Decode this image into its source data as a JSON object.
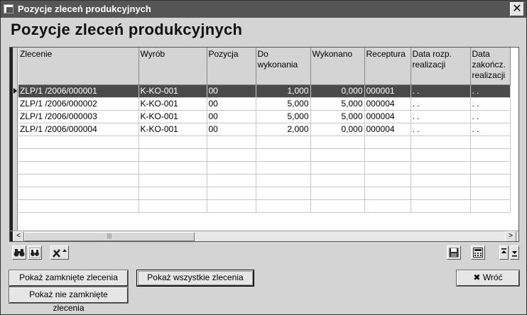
{
  "window": {
    "title": "Pozycje zleceń produkcyjnych",
    "close_glyph": "✕"
  },
  "heading": "Pozycje zleceń produkcyjnych",
  "grid": {
    "columns": [
      {
        "key": "zlecenie",
        "label": "Zlecenie"
      },
      {
        "key": "wyrob",
        "label": "Wyrób"
      },
      {
        "key": "pozycja",
        "label": "Pozycja"
      },
      {
        "key": "do_wykonania",
        "label": "Do wykonania"
      },
      {
        "key": "wykonano",
        "label": "Wykonano"
      },
      {
        "key": "receptura",
        "label": "Receptura"
      },
      {
        "key": "data_rozp",
        "label": "Data rozp. realizacji"
      },
      {
        "key": "data_zak",
        "label": "Data zakończ. realizacji"
      }
    ],
    "rows": [
      {
        "zlecenie": "ZLP/1 /2006/000001",
        "wyrob": "K-KO-001",
        "pozycja": "00",
        "do_wykonania": "1,000",
        "wykonano": "0,000",
        "receptura": "000001",
        "data_rozp": ". .",
        "data_zak": ". ."
      },
      {
        "zlecenie": "ZLP/1 /2006/000002",
        "wyrob": "K-KO-001",
        "pozycja": "00",
        "do_wykonania": "5,000",
        "wykonano": "5,000",
        "receptura": "000004",
        "data_rozp": ". .",
        "data_zak": ". ."
      },
      {
        "zlecenie": "ZLP/1 /2006/000003",
        "wyrob": "K-KO-001",
        "pozycja": "00",
        "do_wykonania": "5,000",
        "wykonano": "5,000",
        "receptura": "000004",
        "data_rozp": ". .",
        "data_zak": ". ."
      },
      {
        "zlecenie": "ZLP/1 /2006/000004",
        "wyrob": "K-KO-001",
        "pozycja": "00",
        "do_wykonania": "2,000",
        "wykonano": "0,000",
        "receptura": "000004",
        "data_rozp": ". .",
        "data_zak": ". ."
      }
    ],
    "selected_row": 0,
    "scroll": {
      "left_glyph": "<",
      "right_glyph": ">",
      "thumb_glyph": "|||"
    }
  },
  "toolbar": {
    "left": [
      "binoculars-icon",
      "binoculars-filter-icon",
      "tools-icon"
    ],
    "right": [
      "save-icon",
      "calculator-icon",
      "collapse-expand-icon"
    ]
  },
  "buttons": {
    "show_closed": "Pokaż zamknięte zlecenia",
    "show_all": "Pokaż wszystkie zlecenia",
    "show_not_closed": "Pokaż nie zamknięte zlecenia",
    "back": "Wróć",
    "back_glyph": "✖"
  }
}
